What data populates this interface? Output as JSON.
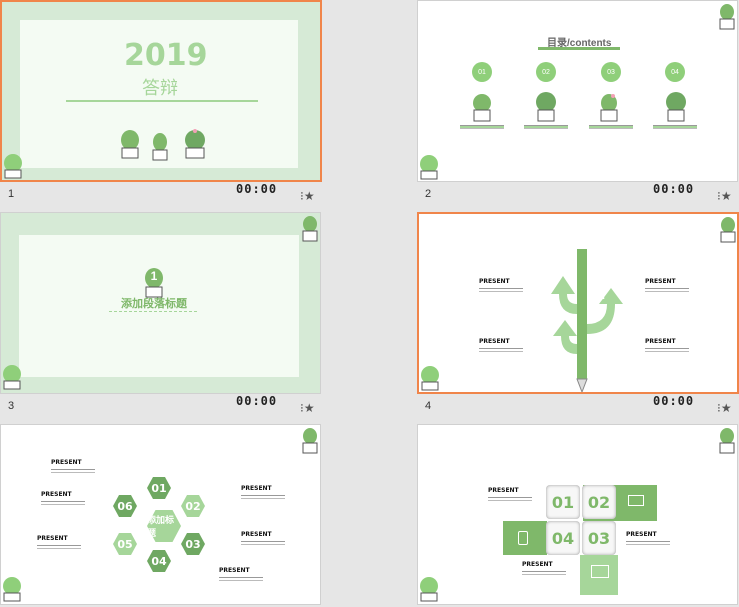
{
  "slides": [
    {
      "number": "1",
      "time": "00:00",
      "title_year": "2019",
      "title_sub": "答辩"
    },
    {
      "number": "2",
      "time": "00:00",
      "title": "目录/contents",
      "items": [
        "01",
        "02",
        "03",
        "04"
      ]
    },
    {
      "number": "3",
      "time": "00:00",
      "badge": "1",
      "section_title": "添加段落标题"
    },
    {
      "number": "4",
      "time": "00:00",
      "arrows": [
        "3",
        "2",
        "1"
      ],
      "label": "PRESENT"
    },
    {
      "number": "",
      "time": "",
      "center": "添加标题",
      "hexes": [
        "01",
        "02",
        "03",
        "04",
        "05",
        "06"
      ],
      "label": "PRESENT"
    },
    {
      "number": "",
      "time": "",
      "squares": [
        "01",
        "02",
        "04",
        "03"
      ],
      "label": "PRESENT"
    }
  ],
  "colors": {
    "accent": "#f0854a",
    "green": "#8fcf7a",
    "dark_green": "#6fa862"
  },
  "icons": {
    "star": "star-icon",
    "cactus": "cactus-icon"
  }
}
